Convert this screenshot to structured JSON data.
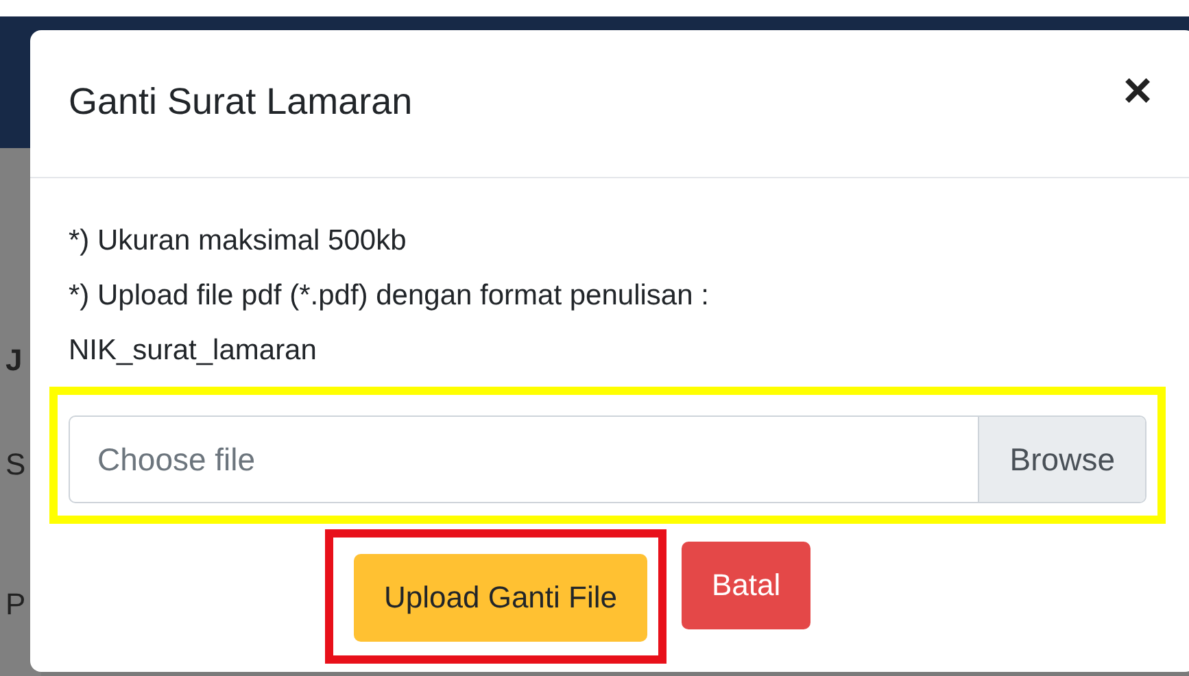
{
  "background": {
    "texts": [
      {
        "text": "J",
        "bold": true
      },
      {
        "text": "S",
        "bold": false
      },
      {
        "text": "P",
        "bold": false
      }
    ]
  },
  "modal": {
    "title": "Ganti Surat Lamaran",
    "close": "×",
    "notes": [
      "*) Ukuran maksimal 500kb",
      "*) Upload file pdf (*.pdf) dengan format penulisan :",
      "NIK_surat_lamaran"
    ],
    "file_input": {
      "placeholder": "Choose file",
      "browse": "Browse",
      "highlighted": true
    },
    "buttons": [
      {
        "label": "Upload Ganti File",
        "kind": "primary",
        "highlighted": true
      },
      {
        "label": "Batal",
        "kind": "danger",
        "highlighted": false
      }
    ]
  }
}
